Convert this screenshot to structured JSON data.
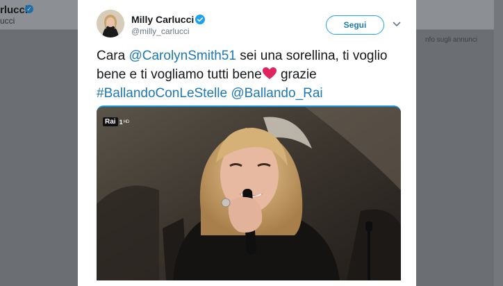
{
  "background": {
    "profile_name": "rlucci",
    "profile_handle": "ucci",
    "ads_info": "nfo sugli annunci"
  },
  "tweet": {
    "display_name": "Milly Carlucci",
    "handle": "@milly_carlucci",
    "follow_label": "Segui",
    "text": {
      "prefix": "Cara ",
      "mention_1": "@CarolynSmith51",
      "middle": " sei una sorellina, ti voglio bene e ti vogliamo tutti bene",
      "after_heart": " grazie",
      "hashtag": "#BallandoConLeStelle",
      "space": " ",
      "mention_2": "@Ballando_Rai"
    }
  },
  "video": {
    "channel_word": "Rai",
    "channel_number": "1",
    "channel_hd": "HD"
  },
  "colors": {
    "link": "#1d78b4",
    "verified": "#1da1f2",
    "heart": "#e0245e"
  },
  "icons": {
    "verified": "verified-badge-icon",
    "caret": "chevron-down-icon",
    "heart": "red-heart-emoji-icon"
  }
}
